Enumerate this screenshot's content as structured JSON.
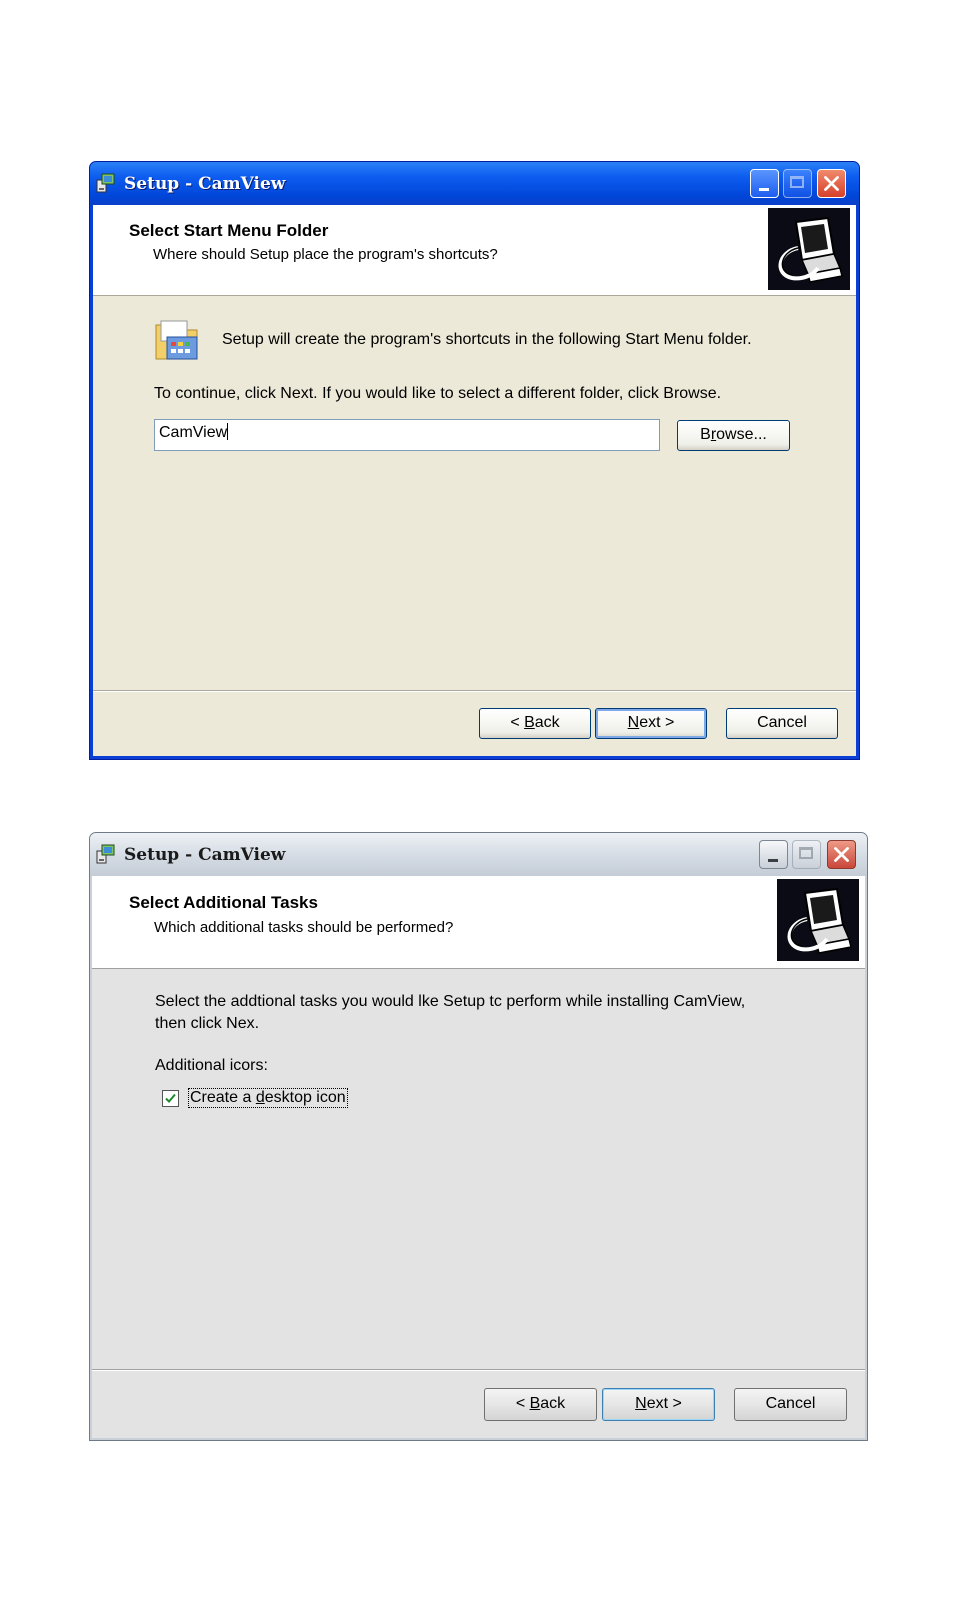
{
  "dialog1": {
    "title": "Setup - CamView",
    "header_title": "Select Start Menu Folder",
    "header_subtitle": "Where should Setup place the program's shortcuts?",
    "info_text": "Setup will create the program's shortcuts in the following Start Menu folder.",
    "instruction_text": "To continue, click Next. If you would like to select a different folder, click Browse.",
    "folder_value": "CamView",
    "browse_button": {
      "pre": "B",
      "key": "r",
      "post": "owse..."
    },
    "back_button": {
      "pre": "< ",
      "key": "B",
      "post": "ack"
    },
    "next_button": {
      "pre": "",
      "key": "N",
      "post": "ext >"
    },
    "cancel_button": "Cancel"
  },
  "dialog2": {
    "title": "Setup - CamView",
    "header_title": "Select Additional Tasks",
    "header_subtitle": "Which additional tasks should be performed?",
    "instruction_line1": "Select the addtional tasks you would lke Setup tc perform while installing CamView,",
    "instruction_line2": "then click Nex.",
    "group_label": "Additional icors:",
    "checkbox": {
      "pre": "Create a ",
      "key": "d",
      "post": "esktop icon",
      "checked": true
    },
    "back_button": {
      "pre": "< ",
      "key": "B",
      "post": "ack"
    },
    "next_button": {
      "pre": "",
      "key": "N",
      "post": "ext >"
    },
    "cancel_button": "Cancel"
  },
  "icons": [
    "setup-app-icon",
    "minimize-icon",
    "maximize-icon",
    "close-icon",
    "computer-install-icon",
    "start-menu-folder-icon",
    "checkmark-icon"
  ],
  "colors": {
    "xp_titlebar": "#0d5cf0",
    "xp_client": "#ece9d8",
    "vista_client": "#e3e3e3",
    "checkmark": "#1c8a2e"
  }
}
